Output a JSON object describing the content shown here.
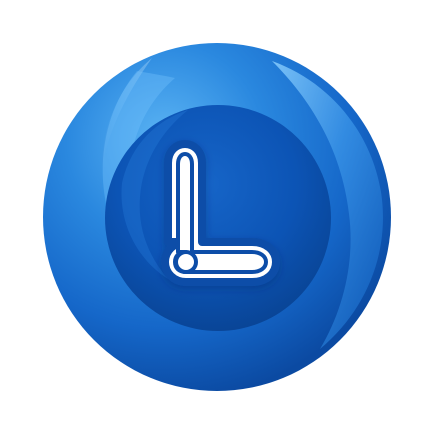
{
  "logo": {
    "letter": "L",
    "icon_name": "app-logo-icon",
    "colors": {
      "background": "#ffffff",
      "outer_blue": "#1f78d1",
      "outer_blue_light": "#3f99ea",
      "outer_blue_dark": "#0d4faa",
      "inner_blue": "#0d57b8",
      "inner_blue_dark": "#08449a",
      "letter_fill": "#ffffff",
      "letter_stroke": "#0b4ea8"
    }
  }
}
